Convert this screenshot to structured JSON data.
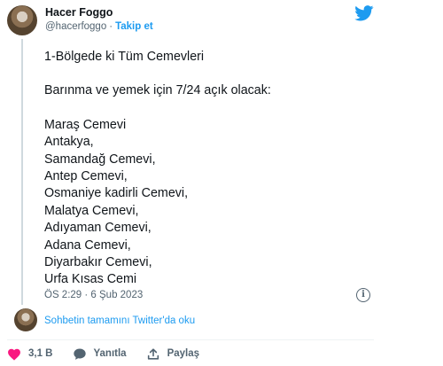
{
  "header": {
    "display_name": "Hacer Foggo",
    "handle": "@hacerfoggo",
    "separator": "·",
    "follow_label": "Takip et"
  },
  "tweet": {
    "lines": [
      "1-Bölgede ki Tüm Cemevleri",
      "",
      "Barınma ve yemek için 7/24 açık olacak:",
      "",
      "Maraş Cemevi",
      "Antakya,",
      "Samandağ Cemevi,",
      "Antep Cemevi,",
      "Osmaniye kadirli Cemevi,",
      "Malatya Cemevi,",
      "Adıyaman Cemevi,",
      "Adana Cemevi,",
      "Diyarbakır Cemevi,",
      "Urfa Kısas Cemi"
    ],
    "timestamp": "ÖS 2:29 · 6 Şub 2023",
    "info_glyph": "i"
  },
  "thread": {
    "read_more": "Sohbetin tamamını Twitter'da oku"
  },
  "actions": {
    "like_count": "3,1 B",
    "reply_label": "Yanıtla",
    "share_label": "Paylaş"
  },
  "colors": {
    "accent": "#1d9bf0",
    "like": "#f91880",
    "text": "#0f1419",
    "muted": "#536471"
  }
}
